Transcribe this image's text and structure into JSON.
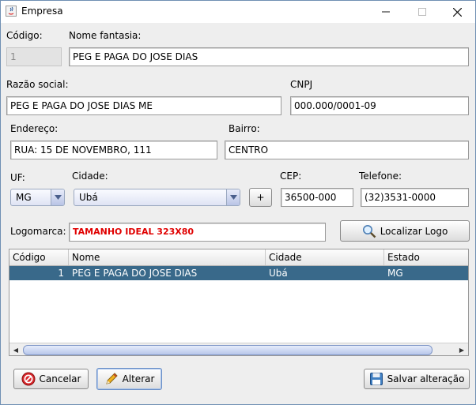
{
  "window": {
    "title": "Empresa"
  },
  "form": {
    "codigo": {
      "label": "Código:",
      "value": "1"
    },
    "nome_fantasia": {
      "label": "Nome fantasia:",
      "value": "PEG E PAGA DO JOSE DIAS"
    },
    "razao_social": {
      "label": "Razão social:",
      "value": "PEG E PAGA DO JOSE DIAS ME"
    },
    "cnpj": {
      "label": "CNPJ",
      "value": "000.000/0001-09"
    },
    "endereco": {
      "label": "Endereço:",
      "value": "RUA: 15 DE NOVEMBRO, 111"
    },
    "bairro": {
      "label": "Bairro:",
      "value": "CENTRO"
    },
    "uf": {
      "label": "UF:",
      "value": "MG"
    },
    "cidade": {
      "label": "Cidade:",
      "value": "Ubá"
    },
    "add_button": "+",
    "cep": {
      "label": "CEP:",
      "value": "36500-000"
    },
    "telefone": {
      "label": "Telefone:",
      "value": "(32)3531-0000"
    },
    "logomarca": {
      "label": "Logomarca:",
      "value": "TAMANHO IDEAL 323X80"
    },
    "localizar_logo": "Localizar Logo"
  },
  "table": {
    "columns": [
      "Código",
      "Nome",
      "Cidade",
      "Estado"
    ],
    "rows": [
      {
        "codigo": "1",
        "nome": "PEG E PAGA DO JOSE DIAS",
        "cidade": "Ubá",
        "estado": "MG"
      }
    ]
  },
  "buttons": {
    "cancelar": "Cancelar",
    "alterar": "Alterar",
    "salvar": "Salvar alteração"
  },
  "colors": {
    "selection": "#39698a",
    "logo_hint": "#e00000"
  }
}
